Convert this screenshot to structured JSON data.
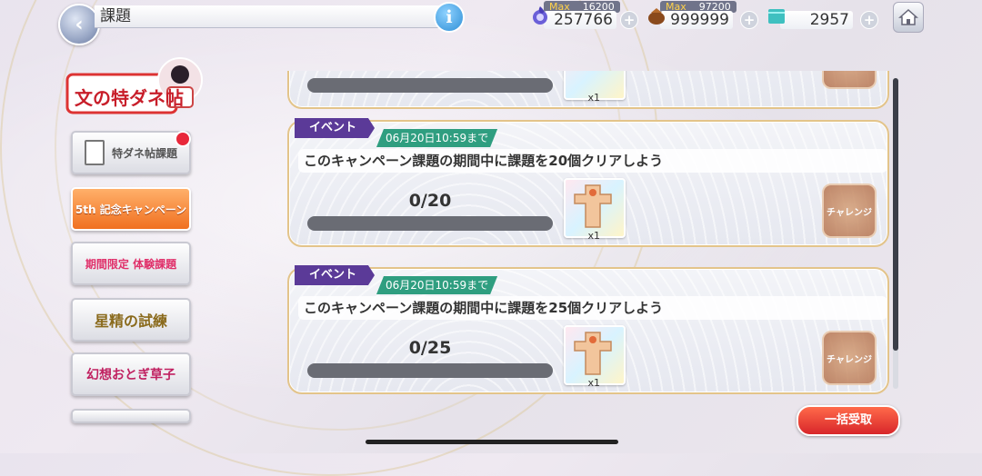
{
  "header": {
    "title": "課題",
    "info_label": "i",
    "resources": [
      {
        "name": "stamina",
        "max_label": "Max",
        "max_value": "16200",
        "value": "257766",
        "icon": "orb-icon",
        "color": "#6a5fd8"
      },
      {
        "name": "coins",
        "max_label": "Max",
        "max_value": "97200",
        "value": "999999",
        "icon": "pouch-icon",
        "color": "#8a4a1c"
      },
      {
        "name": "gems",
        "value": "2957",
        "icon": "gem-icon",
        "color": "#3fc0c0"
      }
    ],
    "plus_label": "+"
  },
  "sidebar": {
    "logo_text": "文の特ダネ帖",
    "items": [
      {
        "label": "特ダネ帖課題",
        "has_badge": true
      },
      {
        "label": "5th 記念キャンペーン"
      },
      {
        "label": "期間限定 体験課題"
      },
      {
        "label": "星精の試練"
      },
      {
        "label": "幻想おとぎ草子"
      }
    ]
  },
  "quests": [
    {
      "tag": "イベント",
      "deadline": "06月20日10:59まで",
      "description": "このキャンペーン課題の期間中に課題を20個クリアしよう",
      "progress_text": "0/20",
      "progress": 0,
      "reward_qty": "x1",
      "challenge_label": "チャレンジ"
    },
    {
      "tag": "イベント",
      "deadline": "06月20日10:59まで",
      "description": "このキャンペーン課題の期間中に課題を25個クリアしよう",
      "progress_text": "0/25",
      "progress": 0,
      "reward_qty": "x1",
      "challenge_label": "チャレンジ"
    }
  ],
  "top_card": {
    "reward_qty": "x1"
  },
  "footer": {
    "claim_all_label": "一括受取"
  }
}
